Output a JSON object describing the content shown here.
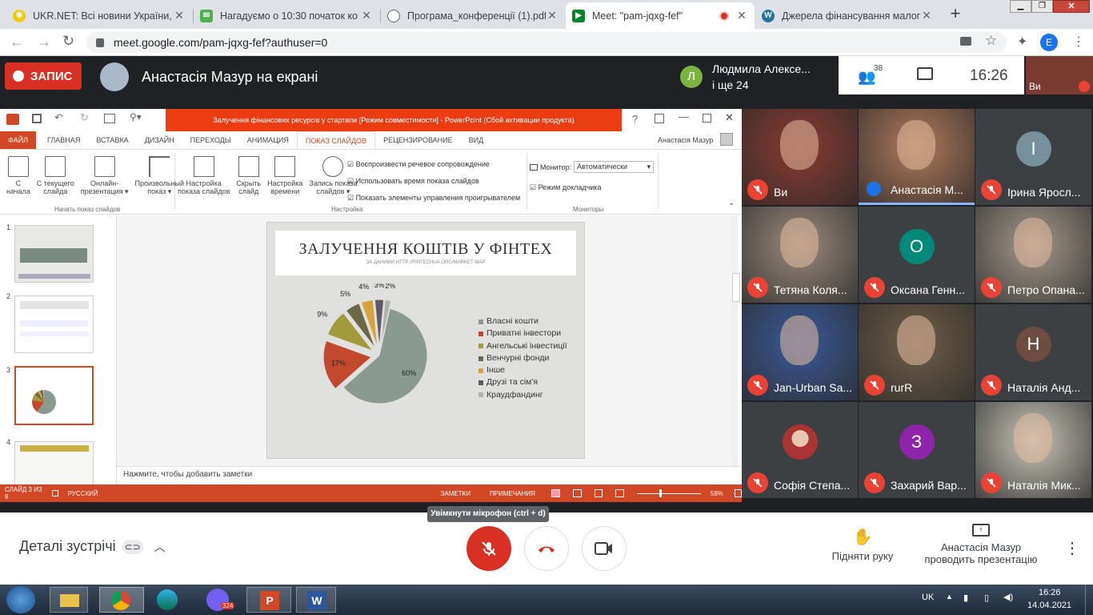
{
  "browser": {
    "tabs": [
      {
        "label": "UKR.NET: Всі новини України, с",
        "icon": "ukrnet-icon",
        "color": "#f5c518"
      },
      {
        "label": "Нагадуємо о 10:30 початок ко",
        "icon": "mail-icon",
        "color": "#4caf50"
      },
      {
        "label": "Програма_конференції (1).pdf",
        "icon": "globe-icon",
        "color": "#5f6368"
      },
      {
        "label": "Meet: \"pam-jqxg-fef\"",
        "icon": "meet-icon",
        "color": "#00832d"
      },
      {
        "label": "Джерела фінансування малого",
        "icon": "wordpress-icon",
        "color": "#21759b"
      }
    ],
    "url": "meet.google.com/pam-jqxg-fef?authuser=0",
    "profile_letter": "E"
  },
  "meet": {
    "record_label": "ЗАПИС",
    "presenter_title": "Анастасія Мазур на екрані",
    "participant_preview_name": "Людмила Алексе...",
    "participant_preview_more": "і ще 24",
    "participant_preview_letter": "Л",
    "people_count": "38",
    "clock": "16:26",
    "self_label": "Ви",
    "tiles": [
      {
        "name": "Ви",
        "type": "video",
        "bg": "#8a3a30"
      },
      {
        "name": "Анастасія М...",
        "type": "video",
        "bg": "#b27a5a",
        "speaking": true
      },
      {
        "name": "Ірина Яросл...",
        "type": "avatar",
        "letter": "І",
        "color": "#78909c"
      },
      {
        "name": "Тетяна Коля...",
        "type": "video",
        "bg": "#9a8a7e"
      },
      {
        "name": "Оксана Генн...",
        "type": "avatar",
        "letter": "О",
        "color": "#00897b"
      },
      {
        "name": "Петро Опана...",
        "type": "video",
        "bg": "#a59a8c"
      },
      {
        "name": "Jan-Urban Sa...",
        "type": "video",
        "bg": "#3a5a9a"
      },
      {
        "name": "rurR",
        "type": "video",
        "bg": "#6f5e48"
      },
      {
        "name": "Наталія Анд...",
        "type": "avatar",
        "letter": "Н",
        "color": "#6d4c41"
      },
      {
        "name": "Софія Степа...",
        "type": "photo",
        "color": "#a33"
      },
      {
        "name": "Захарий Вар...",
        "type": "avatar",
        "letter": "З",
        "color": "#8e24aa"
      },
      {
        "name": "Наталія Мик...",
        "type": "video",
        "bg": "#c8c4b8"
      }
    ],
    "meeting_details": "Деталі зустрічі",
    "mic_tooltip": "Увімкнути мікрофон (ctrl + d)",
    "raise_hand": "Підняти руку",
    "presenting_line1": "Анастасія Мазур",
    "presenting_line2": "проводить презентацію"
  },
  "ppt": {
    "window_title": "Залучення фінансових ресурсів у стартапи [Режим совместимости] - PowerPoint (Сбой активации продукта)",
    "tabs": [
      "ФАЙЛ",
      "ГЛАВНАЯ",
      "ВСТАВКА",
      "ДИЗАЙН",
      "ПЕРЕХОДЫ",
      "АНИМАЦИЯ",
      "ПОКАЗ СЛАЙДОВ",
      "РЕЦЕНЗИРОВАНИЕ",
      "ВИД"
    ],
    "user": "Анастасія Мазур",
    "group1_buttons": [
      {
        "l1": "С",
        "l2": "начала"
      },
      {
        "l1": "С текущего",
        "l2": "слайда"
      },
      {
        "l1": "Онлайн-",
        "l2": "презентация ▾"
      },
      {
        "l1": "Произвольный",
        "l2": "показ ▾"
      }
    ],
    "group1_label": "Начать показ слайдов",
    "group2_buttons": [
      {
        "l1": "Настройка",
        "l2": "показа слайдов"
      },
      {
        "l1": "Скрыть",
        "l2": "слайд"
      },
      {
        "l1": "Настройка",
        "l2": "времени"
      },
      {
        "l1": "Запись показа",
        "l2": "слайдов ▾"
      }
    ],
    "checks": [
      "Воспроизвести речевое сопровождение",
      "Использовать время показа слайдов",
      "Показать элементы управления проигрывателем"
    ],
    "group2_label": "Настройка",
    "monitor_label": "Монитор:",
    "monitor_value": "Автоматически",
    "presenter_view": "Режим докладчика",
    "group3_label": "Мониторы",
    "slide_numbers": [
      "1",
      "2",
      "3",
      "4"
    ],
    "slide_title": "ЗАЛУЧЕННЯ КОШТІВ У ФІНТЕХ",
    "slide_subtitle": "ЗА ДАНИМИ HTTP://FINTECHUA.ORG/MARKET-MAP",
    "notes_placeholder": "Нажмите, чтобы добавить заметки",
    "status_slide": "СЛАЙД 3 ИЗ 8",
    "status_lang": "РУССКИЙ",
    "status_notes": "ЗАМЕТКИ",
    "status_comments": "ПРИМЕЧАНИЯ",
    "zoom": "58%"
  },
  "chart_data": {
    "type": "pie",
    "title": "ЗАЛУЧЕННЯ КОШТІВ У ФІНТЕХ",
    "subtitle": "ЗА ДАНИМИ HTTP://FINTECHUA.ORG/MARKET-MAP",
    "series": [
      {
        "name": "",
        "values": [
          60,
          17,
          9,
          5,
          4,
          3,
          2
        ]
      }
    ],
    "categories": [
      "Власні кошти",
      "Приватні інвестори",
      "Ангельські інвестиції",
      "Венчурні фонди",
      "Інше",
      "Друзі та сім'я",
      "Краудфандинг"
    ],
    "labels": [
      "60%",
      "17%",
      "9%",
      "5%",
      "4%",
      "3%",
      "2%"
    ],
    "colors": [
      "#8a9a90",
      "#c2492e",
      "#a39a3c",
      "#6b6848",
      "#d6a33a",
      "#5e5a6a",
      "#b0b0b0"
    ],
    "legend": "right"
  },
  "taskbar": {
    "lang": "UK",
    "time": "16:26",
    "date": "14.04.2021",
    "apps": [
      "explorer-icon",
      "chrome-icon",
      "edge-icon",
      "viber-icon",
      "powerpoint-icon",
      "word-icon"
    ],
    "viber_badge": "324"
  }
}
